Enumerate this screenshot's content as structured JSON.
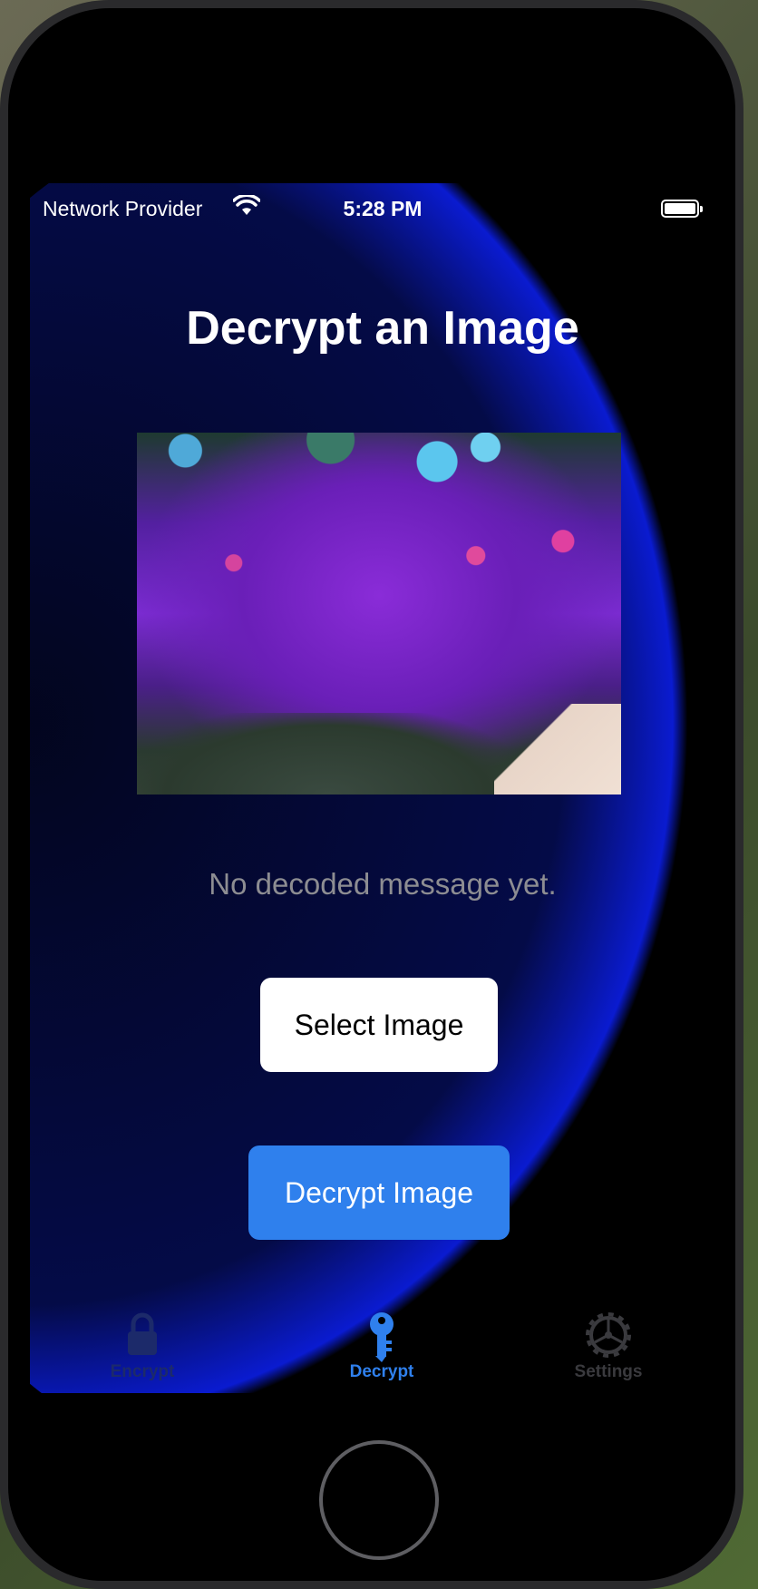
{
  "status_bar": {
    "carrier": "Network Provider",
    "time": "5:28 PM"
  },
  "page": {
    "title": "Decrypt an Image",
    "message": "No decoded message yet."
  },
  "buttons": {
    "select": "Select Image",
    "decrypt": "Decrypt Image"
  },
  "tabs": [
    {
      "label": "Encrypt",
      "icon": "lock-icon",
      "active": false
    },
    {
      "label": "Decrypt",
      "icon": "key-icon",
      "active": true
    },
    {
      "label": "Settings",
      "icon": "gear-icon",
      "active": false
    }
  ],
  "colors": {
    "accent": "#2f80ed",
    "background": "#000000",
    "glow": "#0a1bd0",
    "message_text": "#8d8d92"
  }
}
